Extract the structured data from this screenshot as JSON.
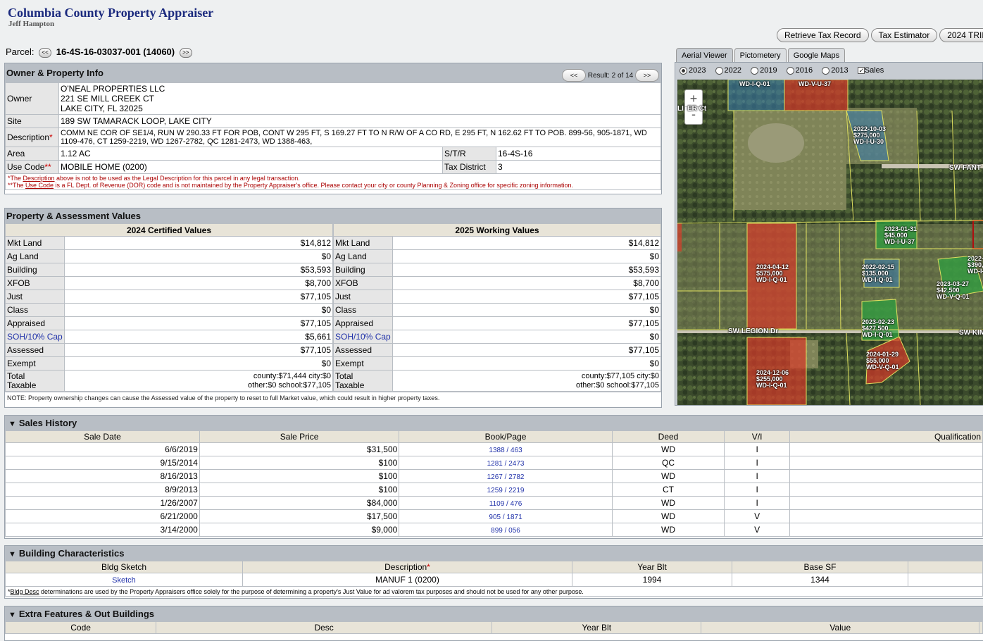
{
  "header": {
    "title": "Columbia County Property Appraiser",
    "subtitle": "Jeff Hampton"
  },
  "top_buttons": [
    "Retrieve Tax Record",
    "Tax Estimator",
    "2024 TRIM (pdf)"
  ],
  "parcel": {
    "label": "Parcel:",
    "prev": "<<",
    "next": ">>",
    "number": "16-4S-16-03037-001 (14060)"
  },
  "owner_panel": {
    "title": "Owner & Property Info",
    "result_prev": "<<",
    "result_next": ">>",
    "result_text": "Result: 2 of 14",
    "owner_label": "Owner",
    "owner_name": "O'NEAL PROPERTIES LLC",
    "owner_addr1": "221 SE MILL CREEK CT",
    "owner_addr2": "LAKE CITY, FL 32025",
    "site_label": "Site",
    "site_value": "189 SW TAMARACK LOOP, LAKE CITY",
    "desc_label": "Description",
    "desc_star": "*",
    "desc_value": "COMM NE COR OF SE1/4, RUN W 290.33 FT FOR POB, CONT W 295 FT, S 169.27 FT TO N R/W OF A CO RD, E 295 FT, N 162.62 FT TO POB. 899-56, 905-1871, WD 1109-476, CT 1259-2219, WD 1267-2782, QC 1281-2473, WD 1388-463,",
    "area_label": "Area",
    "area_value": "1.12 AC",
    "str_label": "S/T/R",
    "str_value": "16-4S-16",
    "use_label": "Use Code",
    "use_star": "**",
    "use_value": "MOBILE HOME (0200)",
    "tax_label": "Tax District",
    "tax_value": "3",
    "note1_a": "*The ",
    "note1_link": "Description",
    "note1_b": " above is not to be used as the Legal Description for this parcel in any legal transaction.",
    "note2_a": "**The ",
    "note2_link": "Use Code",
    "note2_b": " is a FL Dept. of Revenue (DOR) code and is not maintained by the Property Appraiser's office. Please contact your city or county Planning & Zoning office for specific zoning information."
  },
  "values_panel": {
    "title": "Property & Assessment Values",
    "col1": "2024 Certified Values",
    "col2": "2025 Working Values",
    "rows": [
      {
        "label": "Mkt Land",
        "v1": "$14,812",
        "v2": "$14,812"
      },
      {
        "label": "Ag Land",
        "v1": "$0",
        "v2": "$0"
      },
      {
        "label": "Building",
        "v1": "$53,593",
        "v2": "$53,593"
      },
      {
        "label": "XFOB",
        "v1": "$8,700",
        "v2": "$8,700"
      },
      {
        "label": "Just",
        "v1": "$77,105",
        "v2": "$77,105"
      },
      {
        "label": "Class",
        "v1": "$0",
        "v2": "$0"
      },
      {
        "label": "Appraised",
        "v1": "$77,105",
        "v2": "$77,105"
      },
      {
        "label": "SOH/10% Cap",
        "v1": "$5,661",
        "v2": "$0"
      },
      {
        "label": "Assessed",
        "v1": "$77,105",
        "v2": "$77,105"
      },
      {
        "label": "Exempt",
        "v1": "$0",
        "v2": "$0"
      }
    ],
    "total_label1": "Total",
    "total_label2": "Taxable",
    "t1_line1": "county:$71,444 city:$0",
    "t1_line2": "other:$0 school:$77,105",
    "t2_line1": "county:$77,105 city:$0",
    "t2_line2": "other:$0 school:$77,105",
    "note": "NOTE: Property ownership changes can cause the Assessed value of the property to reset to full Market value, which could result in higher property taxes."
  },
  "map": {
    "tabs": [
      "Aerial Viewer",
      "Pictometery",
      "Google Maps"
    ],
    "years": [
      "2023",
      "2022",
      "2019",
      "2016",
      "2013"
    ],
    "sales_label": "Sales",
    "zoom_in": "+",
    "zoom_out": "-",
    "labels": [
      {
        "t": "WD-I-Q-01"
      },
      {
        "t": "WD-V-U-37"
      },
      {
        "t": "2022-10-03"
      },
      {
        "t": "$275,000"
      },
      {
        "t": "WD-I-U-30"
      },
      {
        "t": "2023-01-31"
      },
      {
        "t": "$45,000"
      },
      {
        "t": "WD-I-U-37"
      },
      {
        "t": "2024-04-12"
      },
      {
        "t": "$575,000"
      },
      {
        "t": "WD-I-Q-01"
      },
      {
        "t": "2022-02-15"
      },
      {
        "t": "$135,000"
      },
      {
        "t": "WD-I-Q-01"
      },
      {
        "t": "2023-03-27"
      },
      {
        "t": "$42,500"
      },
      {
        "t": "WD-V-Q-01"
      },
      {
        "t": "2022-0"
      },
      {
        "t": "$390,00"
      },
      {
        "t": "WD-I-C"
      },
      {
        "t": "2023-02-23"
      },
      {
        "t": "$427,500"
      },
      {
        "t": "WD-I-Q-01"
      },
      {
        "t": "2024-01-29"
      },
      {
        "t": "$55,000"
      },
      {
        "t": "WD-V-Q-01"
      },
      {
        "t": "2024-12-06"
      },
      {
        "t": "$255,000"
      },
      {
        "t": "WD-I-Q-01"
      }
    ],
    "roads": [
      "SW FANT",
      "SW LEGION Dr",
      "SW KIM",
      "LI",
      "ER Ct"
    ]
  },
  "sales": {
    "title": "Sales History",
    "headers": [
      "Sale Date",
      "Sale Price",
      "Book/Page",
      "Deed",
      "V/I",
      "Qualification"
    ],
    "rows": [
      {
        "date": "6/6/2019",
        "price": "$31,500",
        "book": "1388 / 463",
        "deed": "WD",
        "vi": "I"
      },
      {
        "date": "9/15/2014",
        "price": "$100",
        "book": "1281 / 2473",
        "deed": "QC",
        "vi": "I"
      },
      {
        "date": "8/16/2013",
        "price": "$100",
        "book": "1267 / 2782",
        "deed": "WD",
        "vi": "I"
      },
      {
        "date": "8/9/2013",
        "price": "$100",
        "book": "1259 / 2219",
        "deed": "CT",
        "vi": "I"
      },
      {
        "date": "1/26/2007",
        "price": "$84,000",
        "book": "1109 / 476",
        "deed": "WD",
        "vi": "I"
      },
      {
        "date": "6/21/2000",
        "price": "$17,500",
        "book": "905 / 1871",
        "deed": "WD",
        "vi": "V"
      },
      {
        "date": "3/14/2000",
        "price": "$9,000",
        "book": "899 / 056",
        "deed": "WD",
        "vi": "V"
      }
    ]
  },
  "building": {
    "title": "Building Characteristics",
    "headers": [
      "Bldg Sketch",
      "Description",
      "Year Blt",
      "Base SF"
    ],
    "desc_star": "*",
    "row": {
      "sketch": "Sketch",
      "desc": "MANUF 1 (0200)",
      "year": "1994",
      "sf": "1344"
    },
    "note_a": "*",
    "note_link": "Bldg Desc",
    "note_b": " determinations are used by the Property Appraisers office solely for the purpose of determining a property's Just Value for ad valorem tax purposes and should not be used for any other purpose."
  },
  "extra": {
    "title": "Extra Features & Out Buildings",
    "headers": [
      "Code",
      "Desc",
      "Year Blt",
      "Value"
    ]
  }
}
